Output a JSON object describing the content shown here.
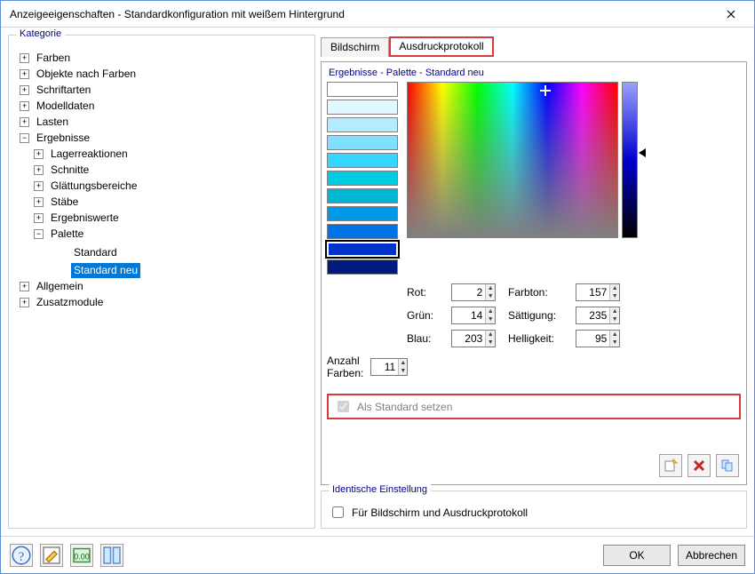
{
  "window": {
    "title": "Anzeigeeigenschaften - Standardkonfiguration mit weißem Hintergrund"
  },
  "leftpane": {
    "legend": "Kategorie"
  },
  "tree": {
    "items": [
      {
        "label": "Farben"
      },
      {
        "label": "Objekte nach Farben"
      },
      {
        "label": "Schriftarten"
      },
      {
        "label": "Modelldaten"
      },
      {
        "label": "Lasten"
      },
      {
        "label": "Ergebnisse",
        "expanded": true,
        "children": [
          {
            "label": "Lagerreaktionen"
          },
          {
            "label": "Schnitte"
          },
          {
            "label": "Glättungsbereiche"
          },
          {
            "label": "Stäbe"
          },
          {
            "label": "Ergebniswerte"
          },
          {
            "label": "Palette",
            "expanded": true,
            "children": [
              {
                "label": "Standard",
                "leaf": true
              },
              {
                "label": "Standard neu",
                "leaf": true,
                "selected": true
              }
            ]
          }
        ]
      },
      {
        "label": "Allgemein"
      },
      {
        "label": "Zusatzmodule"
      }
    ]
  },
  "tabs": {
    "items": [
      {
        "label": "Bildschirm",
        "highlighted": false,
        "active": false
      },
      {
        "label": "Ausdruckprotokoll",
        "highlighted": true,
        "active": true
      }
    ]
  },
  "panel": {
    "subheader": "Ergebnisse - Palette - Standard neu",
    "swatch_colors": [
      "#ffffff",
      "#e0f7ff",
      "#b3ecff",
      "#80e0ff",
      "#33d6ff",
      "#00cce6",
      "#00b8d4",
      "#0099e6",
      "#0073e6",
      "#0033cc",
      "#001a80"
    ],
    "selected_swatch_index": 9,
    "rgb": {
      "r_label": "Rot:",
      "r": "2",
      "g_label": "Grün:",
      "g": "14",
      "b_label": "Blau:",
      "b": "203"
    },
    "hsv": {
      "h_label": "Farbton:",
      "h": "157",
      "s_label": "Sättigung:",
      "s": "235",
      "v_label": "Helligkeit:",
      "v": "95"
    },
    "count_label": "Anzahl\nFarben:",
    "count_label_line1": "Anzahl",
    "count_label_line2": "Farben:",
    "count": "11",
    "set_default_label": "Als Standard setzen",
    "set_default_checked": true,
    "picker_cursor": {
      "x_pct": 65,
      "y_pct": 5
    },
    "lightness_arrow_pct": 45
  },
  "ident": {
    "legend": "Identische Einstellung",
    "checkbox_label": "Für Bildschirm und Ausdruckprotokoll",
    "checked": false
  },
  "footer": {
    "ok": "OK",
    "cancel": "Abbrechen"
  },
  "icons": {
    "new": "new-icon",
    "delete": "delete-icon",
    "copy": "copy-icon",
    "help": "help-icon",
    "edit": "edit-icon",
    "grid": "grid-icon",
    "columns": "columns-icon"
  }
}
